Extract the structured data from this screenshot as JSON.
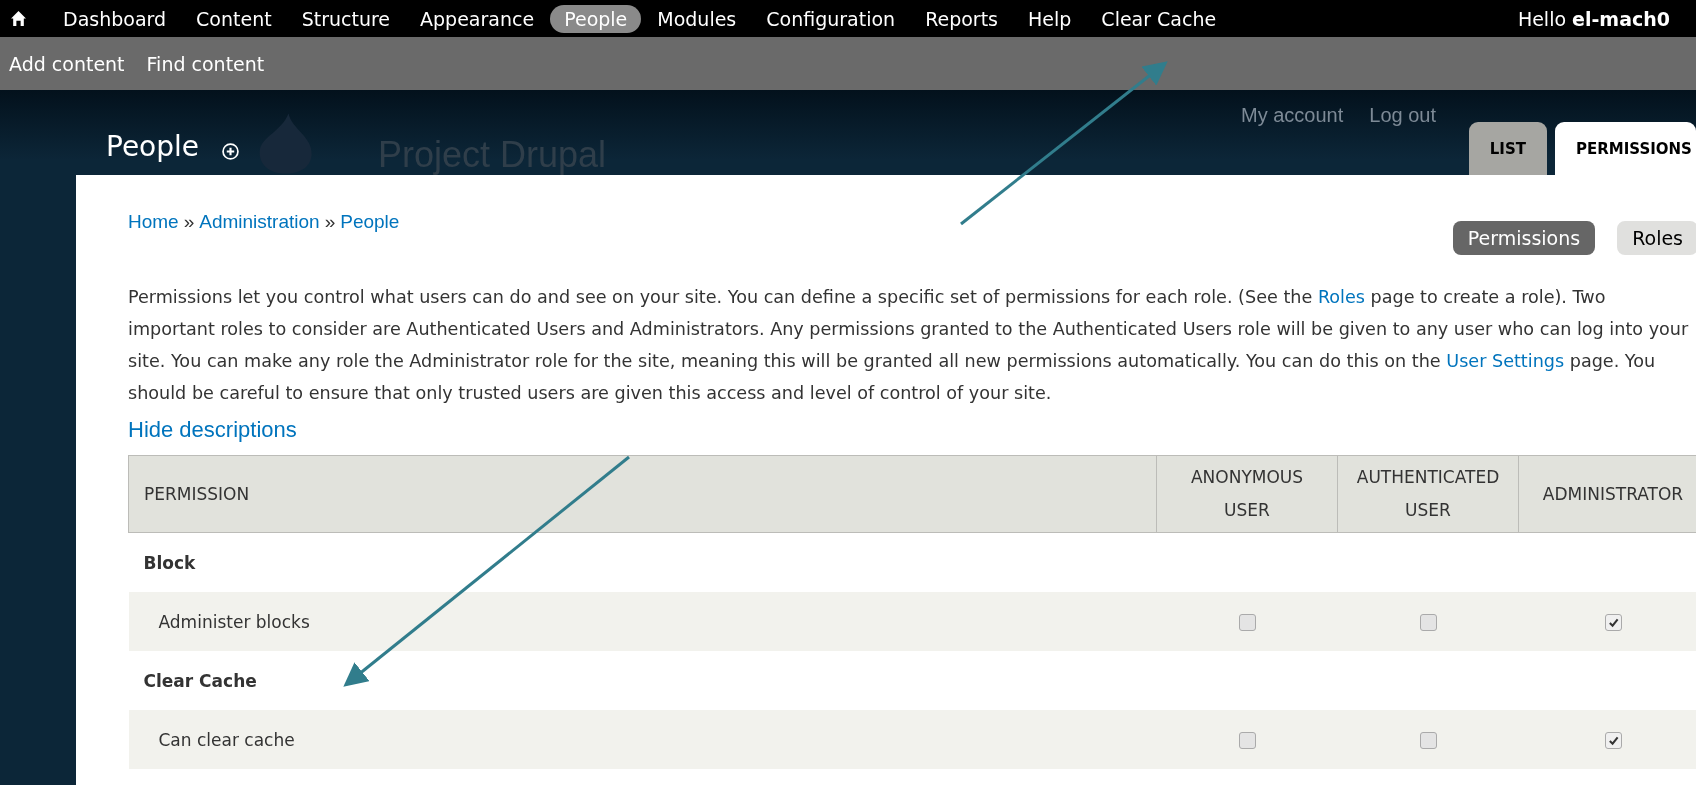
{
  "toolbar": {
    "items": [
      {
        "label": "Dashboard",
        "selected": false
      },
      {
        "label": "Content",
        "selected": false
      },
      {
        "label": "Structure",
        "selected": false
      },
      {
        "label": "Appearance",
        "selected": false
      },
      {
        "label": "People",
        "selected": true
      },
      {
        "label": "Modules",
        "selected": false
      },
      {
        "label": "Configuration",
        "selected": false
      },
      {
        "label": "Reports",
        "selected": false
      },
      {
        "label": "Help",
        "selected": false
      },
      {
        "label": "Clear Cache",
        "selected": false
      }
    ],
    "greeting": "Hello **el-mach0**"
  },
  "shortcuts": [
    "Add content",
    "Find content"
  ],
  "header": {
    "title": "People",
    "site_name": "Project Drupal",
    "user_links": [
      "My account",
      "Log out"
    ],
    "tabs": [
      {
        "label": "LIST",
        "selected": false
      },
      {
        "label": "PERMISSIONS",
        "selected": true
      }
    ]
  },
  "breadcrumb": [
    "Home",
    "Administration",
    "People"
  ],
  "breadcrumb_separator": "»",
  "secondary_tabs": [
    {
      "label": "Permissions",
      "selected": true
    },
    {
      "label": "Roles",
      "selected": false
    }
  ],
  "description": [
    {
      "text": "Permissions let you control what users can do and see on your site. You can define a specific set of permissions for each role. (See the ",
      "kind": "text"
    },
    {
      "text": "Roles",
      "kind": "link"
    },
    {
      "text": " page to create a role). Two important roles to consider are Authenticated Users and Administrators. Any permissions granted to the Authenticated Users role will be given to any user who can log into your site. You can make any role the Administrator role for the site, meaning this will be granted all new permissions automatically. You can do this on the ",
      "kind": "text"
    },
    {
      "text": "User Settings",
      "kind": "link"
    },
    {
      "text": " page. You should be careful to ensure that only trusted users are given this access and level of control of your site.",
      "kind": "text"
    }
  ],
  "hide_descriptions": "Hide descriptions",
  "table": {
    "columns": [
      "PERMISSION",
      "ANONYMOUS USER",
      "AUTHENTICATED USER",
      "ADMINISTRATOR"
    ],
    "rows": [
      {
        "kind": "module",
        "label": "Block"
      },
      {
        "kind": "permission",
        "label": "Administer blocks",
        "checks": [
          {
            "checked": false
          },
          {
            "checked": false
          },
          {
            "checked": true
          }
        ]
      },
      {
        "kind": "module",
        "label": "Clear Cache"
      },
      {
        "kind": "permission",
        "label": "Can clear cache",
        "checks": [
          {
            "checked": false
          },
          {
            "checked": false
          },
          {
            "checked": true
          }
        ]
      }
    ]
  }
}
